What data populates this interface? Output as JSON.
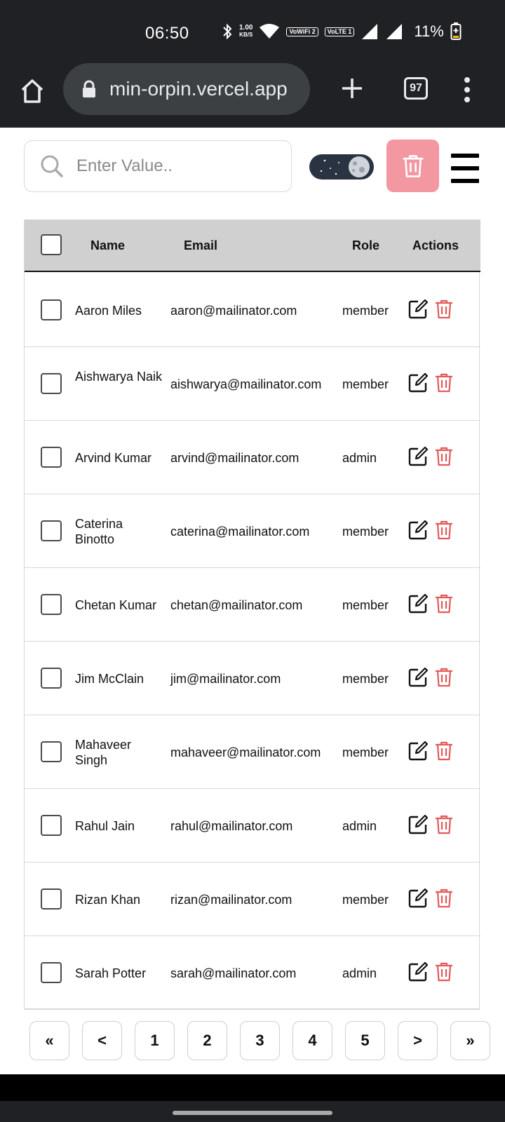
{
  "status_bar": {
    "time": "06:50",
    "speed_value": "1.00",
    "speed_unit": "KB/S",
    "wifi_call_label": "VoWiFi 2",
    "lte_label": "VoLTE 1",
    "battery": "11%"
  },
  "browser": {
    "url": "min-orpin.vercel.app",
    "tab_count": "97"
  },
  "search": {
    "placeholder": "Enter Value.."
  },
  "colors": {
    "delete_button_bg": "#f397a1",
    "delete_icon": "#e35a5a",
    "header_bg": "#d0d0d0",
    "toggle_bg": "#2a3342"
  },
  "table": {
    "headers": {
      "name": "Name",
      "email": "Email",
      "role": "Role",
      "actions": "Actions"
    },
    "rows": [
      {
        "name": "Aaron Miles",
        "email": "aaron@mailinator.com",
        "role": "member"
      },
      {
        "name": "Aishwarya Naik",
        "email": "aishwarya@mailinator.com",
        "role": "member"
      },
      {
        "name": "Arvind Kumar",
        "email": "arvind@mailinator.com",
        "role": "admin"
      },
      {
        "name": "Caterina Binotto",
        "email": "caterina@mailinator.com",
        "role": "member"
      },
      {
        "name": "Chetan Kumar",
        "email": "chetan@mailinator.com",
        "role": "member"
      },
      {
        "name": "Jim McClain",
        "email": "jim@mailinator.com",
        "role": "member"
      },
      {
        "name": "Mahaveer Singh",
        "email": "mahaveer@mailinator.com",
        "role": "member"
      },
      {
        "name": "Rahul Jain",
        "email": "rahul@mailinator.com",
        "role": "admin"
      },
      {
        "name": "Rizan Khan",
        "email": "rizan@mailinator.com",
        "role": "member"
      },
      {
        "name": "Sarah Potter",
        "email": "sarah@mailinator.com",
        "role": "admin"
      }
    ]
  },
  "pagination": {
    "first": "«",
    "prev": "<",
    "pages": [
      "1",
      "2",
      "3",
      "4",
      "5"
    ],
    "next": ">",
    "last": "»"
  }
}
